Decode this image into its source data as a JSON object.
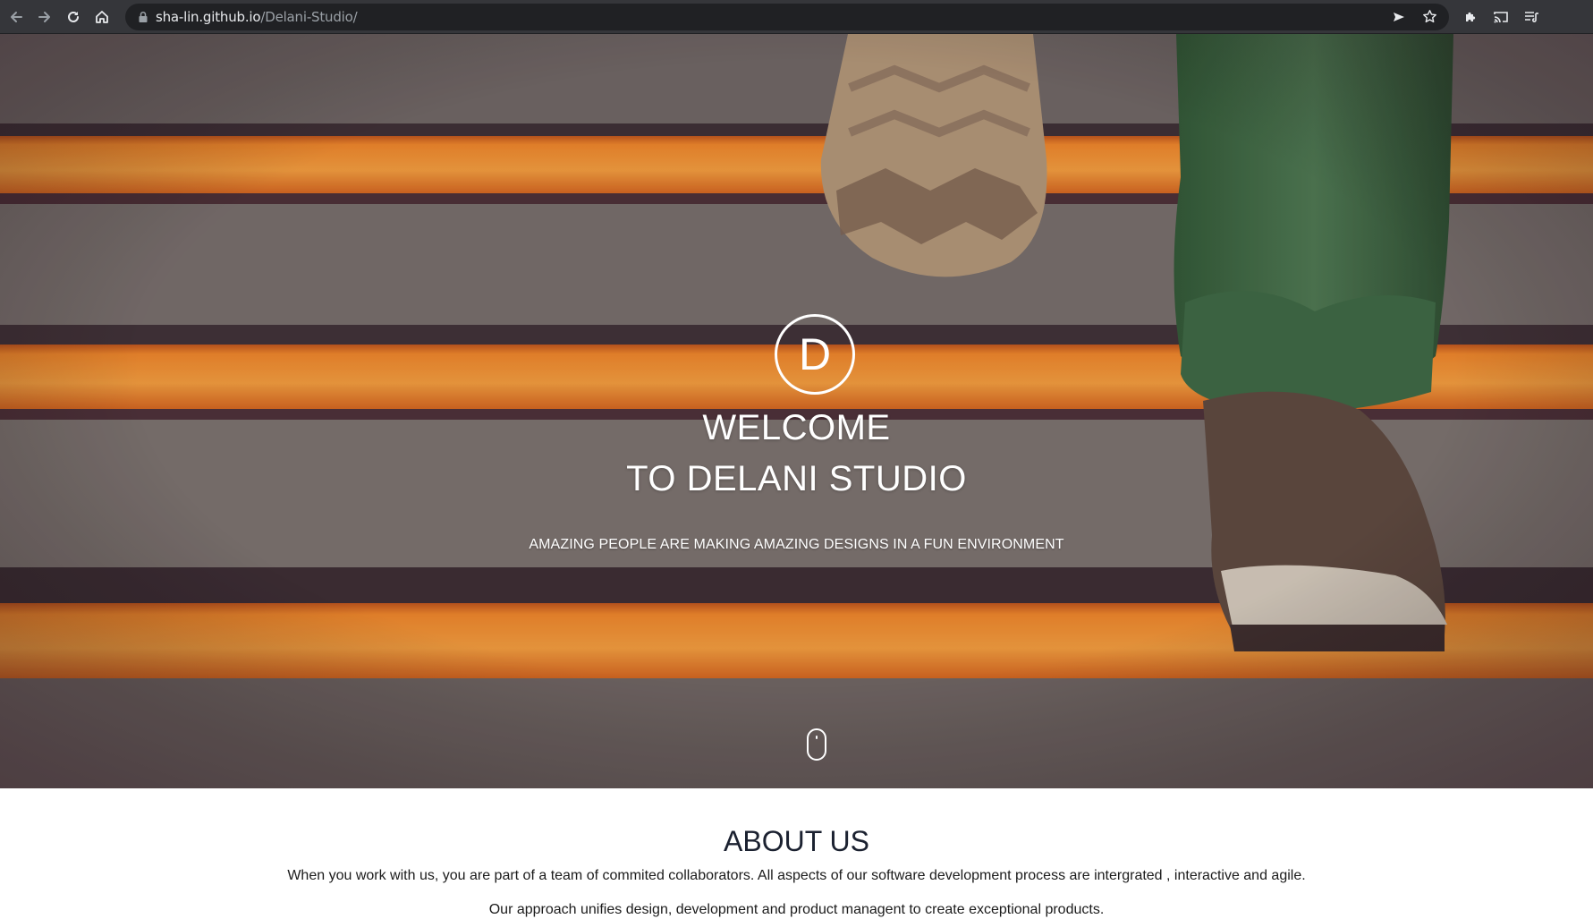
{
  "browser": {
    "url_host": "sha-lin.github.io",
    "url_path": "/Delani-Studio/",
    "icons": [
      "back-icon",
      "forward-icon",
      "reload-icon",
      "home-icon",
      "lock-icon",
      "send-icon",
      "star-icon",
      "extensions-icon",
      "cast-icon",
      "media-control-icon"
    ]
  },
  "hero": {
    "logo_letter": "D",
    "title_line1": "WELCOME",
    "title_line2": "TO DELANI STUDIO",
    "tagline": "AMAZING PEOPLE ARE MAKING AMAZING DESIGNS IN A FUN ENVIRONMENT"
  },
  "about": {
    "title": "ABOUT US",
    "paragraph1": "When you work with us, you are part of a team of commited collaborators. All aspects of our software development process are intergrated , interactive and agile.",
    "paragraph2": "Our approach unifies design, development and product managent to create exceptional products."
  },
  "colors": {
    "toolbar": "#35363a",
    "omnibox": "#202124",
    "stripe_orange": "#f0932e",
    "step_gray": "#7d7773",
    "pants_green": "#3f6b45"
  }
}
